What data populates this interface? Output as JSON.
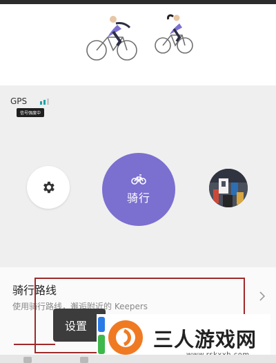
{
  "gps": {
    "label": "GPS",
    "tooltip": "信号强度中"
  },
  "start": {
    "label": "骑行"
  },
  "route": {
    "title": "骑行路线",
    "subtitle": "使用骑行路线，邂逅附近的 Keepers"
  },
  "toast": {
    "text": "设置"
  },
  "watermark": {
    "brand": "三人游戏网",
    "url": "www.rskxxh.com"
  },
  "colors": {
    "accent": "#7b6fd0",
    "gps_bars": "#1ea2a8",
    "annotation": "#9e2929",
    "watermark_orange": "#f07a22"
  },
  "icons": {
    "settings": "gear-icon",
    "bike": "bike-icon",
    "chevron": "chevron-right-icon",
    "avatar": "avatar",
    "watermark_logo": "sanren-logo-icon"
  }
}
